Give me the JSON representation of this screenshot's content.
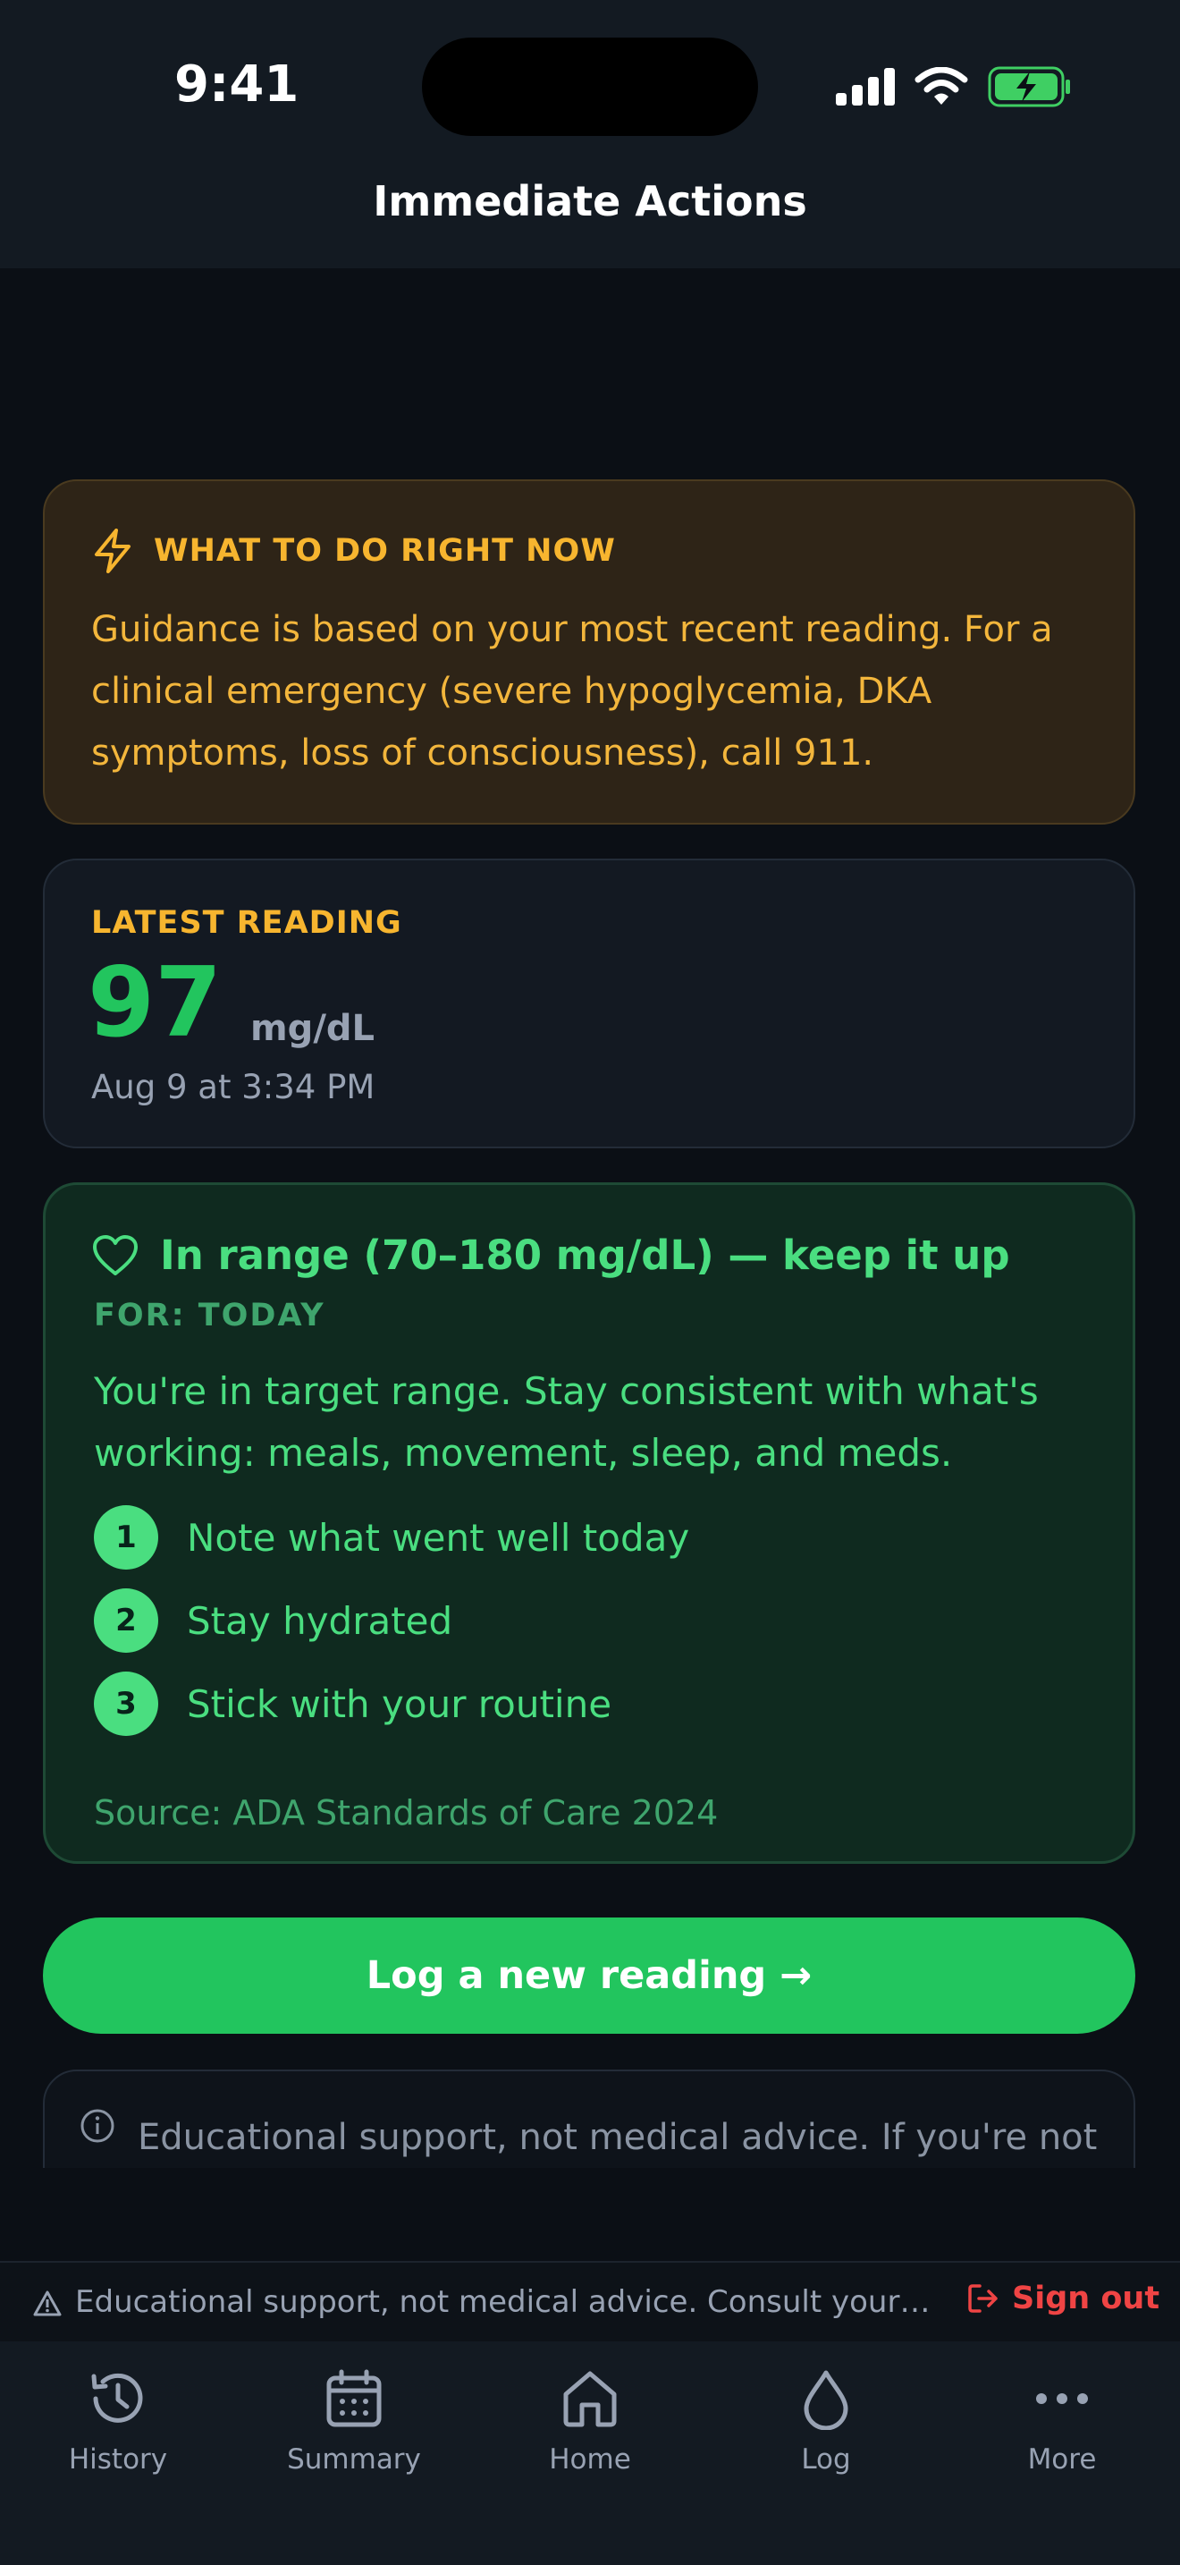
{
  "status_bar": {
    "time": "9:41"
  },
  "header": {
    "title": "Immediate Actions"
  },
  "alert": {
    "title": "WHAT TO DO RIGHT NOW",
    "body": "Guidance is based on your most recent reading. For a clinical emergency (severe hypoglycemia, DKA symptoms, loss of consciousness), call 911."
  },
  "reading": {
    "label": "LATEST READING",
    "value": "97",
    "unit": "mg/dL",
    "timestamp": "Aug 9 at 3:34 PM"
  },
  "guidance": {
    "title": "In range (70–180 mg/dL) — keep it up",
    "for_label": "FOR: TODAY",
    "body": "You're in target range. Stay consistent with what's working: meals, movement, sleep, and meds.",
    "steps": [
      {
        "num": "1",
        "text": "Note what went well today"
      },
      {
        "num": "2",
        "text": "Stay hydrated"
      },
      {
        "num": "3",
        "text": "Stick with your routine"
      }
    ],
    "source": "Source: ADA Standards of Care 2024"
  },
  "log_button": {
    "label": "Log a new reading →"
  },
  "disclaimer": {
    "text": "Educational support, not medical advice. If you're not sure what to do, call your care team."
  },
  "footer": {
    "text": "Educational support, not medical advice. Consult your car...",
    "sign_out": "Sign out"
  },
  "tabs": [
    {
      "label": "History",
      "icon": "history-icon"
    },
    {
      "label": "Summary",
      "icon": "calendar-icon"
    },
    {
      "label": "Home",
      "icon": "home-icon"
    },
    {
      "label": "Log",
      "icon": "drop-icon"
    },
    {
      "label": "More",
      "icon": "more-icon"
    }
  ],
  "colors": {
    "accent_green": "#22c55e",
    "warning_amber": "#f7b52f",
    "danger_red": "#ef4444",
    "background": "#0b0f15"
  }
}
